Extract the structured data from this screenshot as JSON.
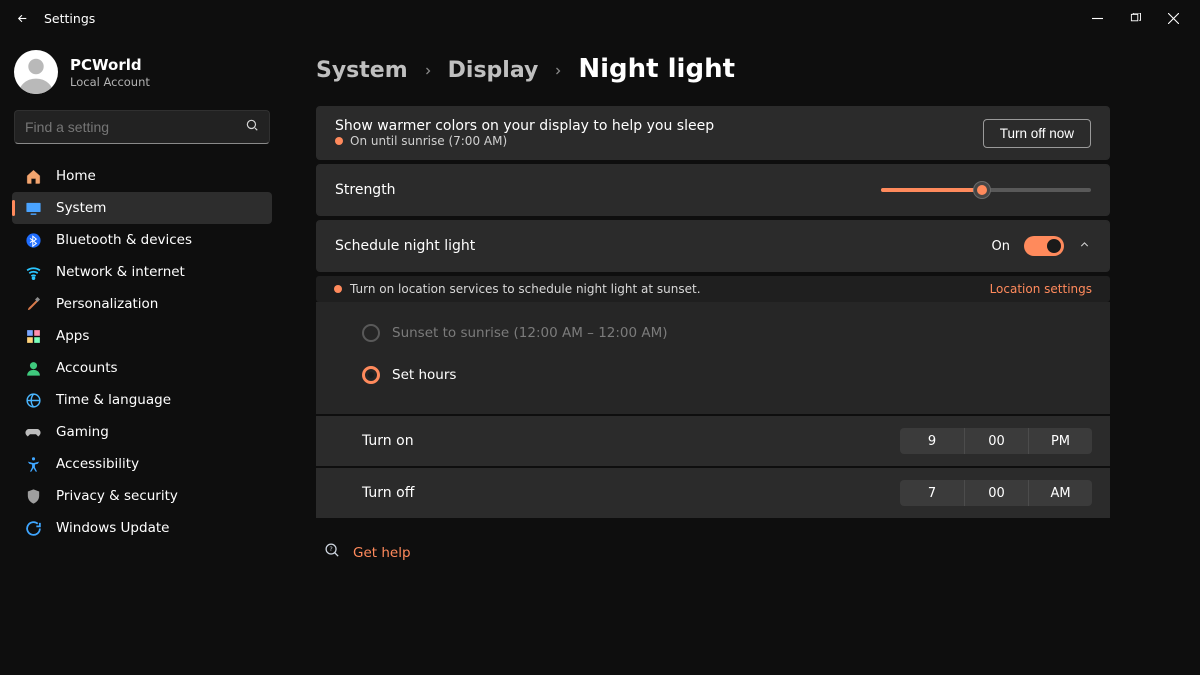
{
  "window_title": "Settings",
  "user": {
    "name": "PCWorld",
    "account_type": "Local Account"
  },
  "search": {
    "placeholder": "Find a setting"
  },
  "sidebar": {
    "items": [
      {
        "label": "Home"
      },
      {
        "label": "System"
      },
      {
        "label": "Bluetooth & devices"
      },
      {
        "label": "Network & internet"
      },
      {
        "label": "Personalization"
      },
      {
        "label": "Apps"
      },
      {
        "label": "Accounts"
      },
      {
        "label": "Time & language"
      },
      {
        "label": "Gaming"
      },
      {
        "label": "Accessibility"
      },
      {
        "label": "Privacy & security"
      },
      {
        "label": "Windows Update"
      }
    ],
    "active_index": 1
  },
  "breadcrumb": {
    "level1": "System",
    "level2": "Display",
    "current": "Night light"
  },
  "night_light": {
    "description": "Show warmer colors on your display to help you sleep",
    "status_text": "On until sunrise (7:00 AM)",
    "turn_off_label": "Turn off now",
    "strength": {
      "label": "Strength",
      "percent": 48
    },
    "schedule": {
      "label": "Schedule night light",
      "state_text": "On",
      "on": true,
      "location_banner": "Turn on location services to schedule night light at sunset.",
      "location_link": "Location settings",
      "option_sunset": {
        "label": "Sunset to sunrise (12:00 AM – 12:00 AM)",
        "enabled": false,
        "selected": false
      },
      "option_set_hours": {
        "label": "Set hours",
        "enabled": true,
        "selected": true
      },
      "turn_on": {
        "label": "Turn on",
        "hour": "9",
        "minute": "00",
        "ampm": "PM"
      },
      "turn_off": {
        "label": "Turn off",
        "hour": "7",
        "minute": "00",
        "ampm": "AM"
      }
    }
  },
  "help": {
    "label": "Get help"
  }
}
